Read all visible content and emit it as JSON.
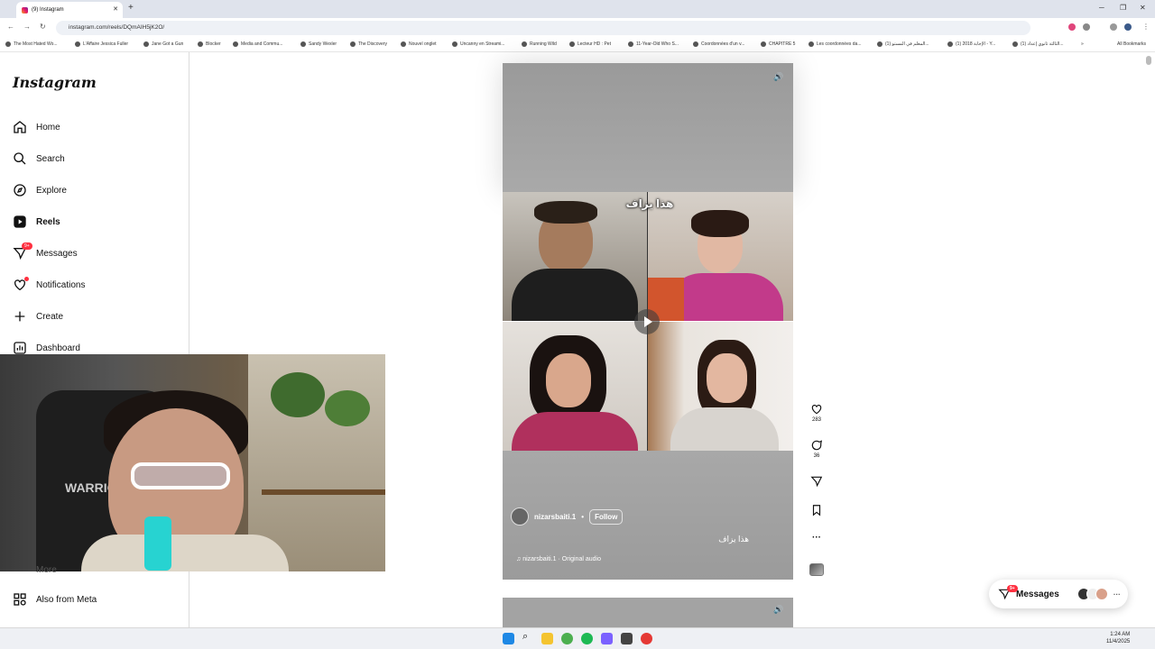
{
  "browser": {
    "tab_title": "(9) Instagram",
    "url": "instagram.com/reels/DQmAIH5jK2O/",
    "new_tab": "+",
    "bookmarks": [
      "The Most Hated Wo...",
      "L'Affaire Jessica Fuller",
      "Jane Got a Gun",
      "Blocker",
      "Media and Commu...",
      "Sandy Wexler",
      "The Discovery",
      "Nouvel onglet",
      "Uncanny en Streami...",
      "Running Wild",
      "Lecteur HD : Pet",
      "11-Year-Old Who S...",
      "Coordonnées d'un v...",
      "CHAPITRE 5",
      "Les coordonnées da...",
      "(1) المعلم في المستو...",
      "(1) الإجابة 2018 - Y...",
      "(1) الثالثة ثانوي إعداد...",
      "»"
    ],
    "all_bookmarks": "All Bookmarks"
  },
  "sidebar": {
    "logo": "Instagram",
    "items": [
      {
        "label": "Home",
        "icon": "home-icon"
      },
      {
        "label": "Search",
        "icon": "search-icon"
      },
      {
        "label": "Explore",
        "icon": "compass-icon"
      },
      {
        "label": "Reels",
        "icon": "reels-icon",
        "active": true
      },
      {
        "label": "Messages",
        "icon": "messenger-icon",
        "badge": "9+"
      },
      {
        "label": "Notifications",
        "icon": "heart-icon",
        "dot": true
      },
      {
        "label": "Create",
        "icon": "plus-icon"
      },
      {
        "label": "Dashboard",
        "icon": "dashboard-icon"
      }
    ],
    "more": "More",
    "also_from_meta": "Also from Meta"
  },
  "reel": {
    "overlay_text": "هذا يزاف",
    "author": "nizarsbaiti.1",
    "separator": "•",
    "follow": "Follow",
    "caption": "هذا يزاف",
    "audio": "♫ nizarsbaiti.1 · Original audio",
    "likes": "283",
    "comments": "36"
  },
  "messages_pill": {
    "label": "Messages",
    "badge": "9+"
  },
  "taskbar": {
    "time": "1:24 AM",
    "date": "11/4/2025"
  }
}
